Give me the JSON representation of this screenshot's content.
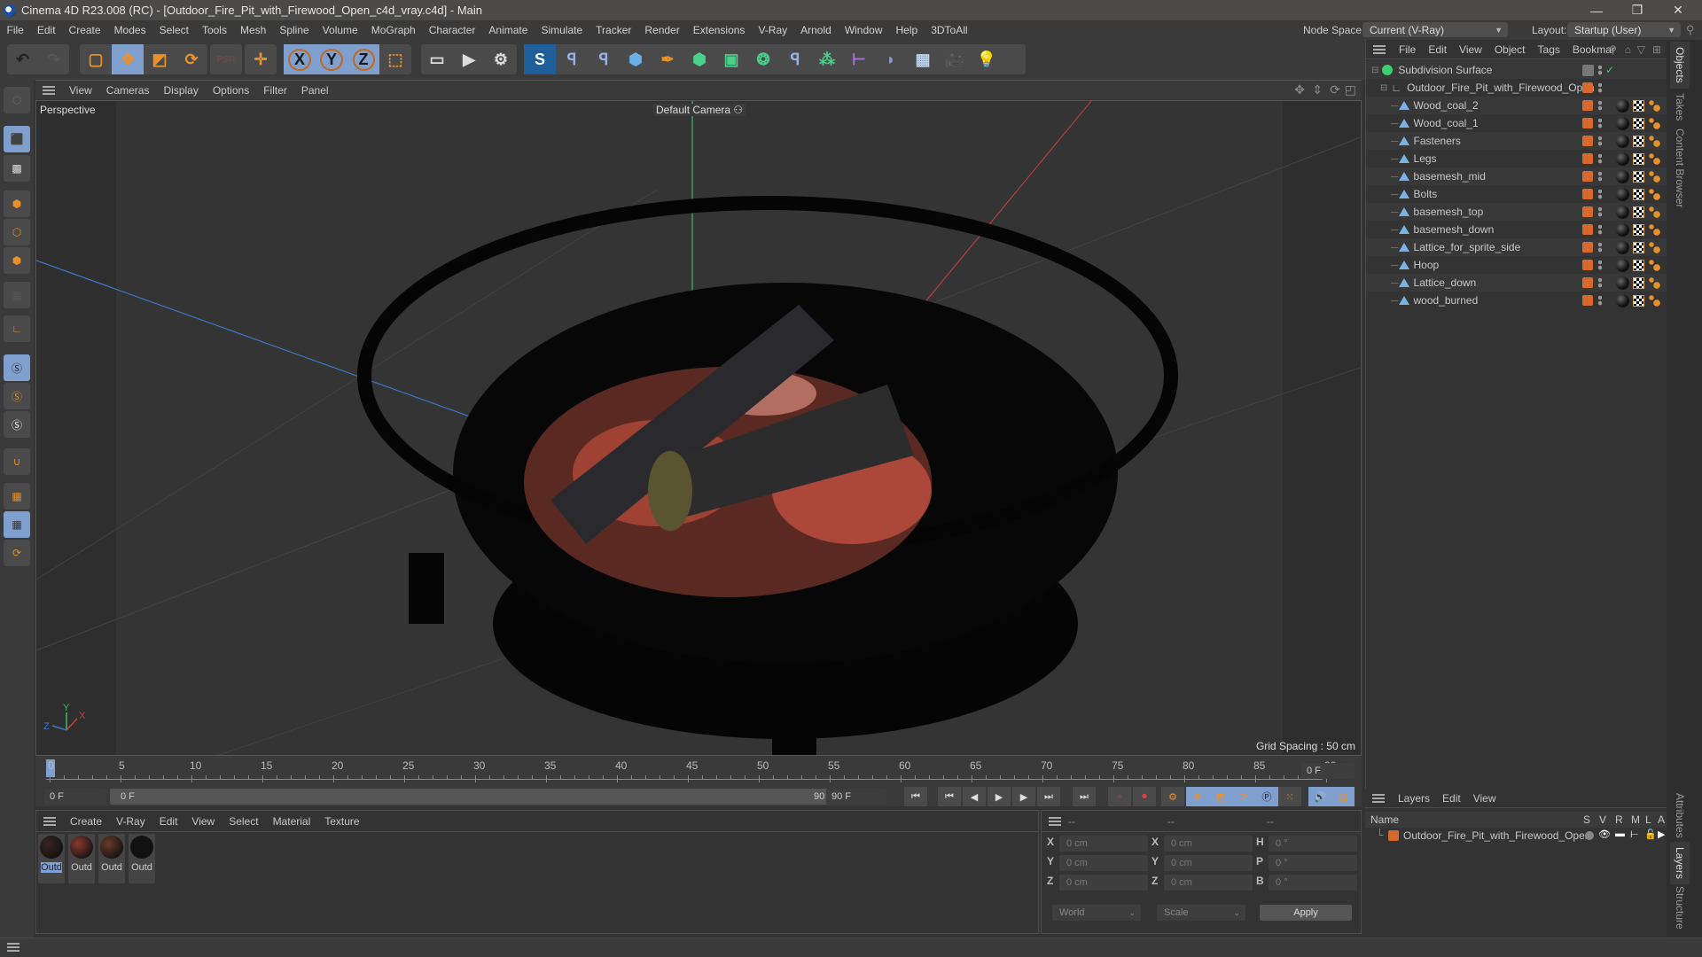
{
  "window": {
    "title": "Cinema 4D R23.008 (RC) - [Outdoor_Fire_Pit_with_Firewood_Open_c4d_vray.c4d] - Main",
    "controls": {
      "minimize": "—",
      "maximize": "❐",
      "close": "✕"
    }
  },
  "menubar": {
    "items": [
      "File",
      "Edit",
      "Create",
      "Modes",
      "Select",
      "Tools",
      "Mesh",
      "Spline",
      "Volume",
      "MoGraph",
      "Character",
      "Animate",
      "Simulate",
      "Tracker",
      "Render",
      "Extensions",
      "V-Ray",
      "Arnold",
      "Window",
      "Help",
      "3DToAll"
    ],
    "node_space_label": "Node Space:",
    "node_space_value": "Current (V-Ray)",
    "layout_label": "Layout:",
    "layout_value": "Startup (User)"
  },
  "toolbar": {
    "icons": [
      "undo-icon",
      "redo-icon",
      "live-selection-icon",
      "move-icon",
      "scale-icon",
      "rotate-icon",
      "psr-icon",
      "coordinate-system-icon",
      "x-axis-icon",
      "y-axis-icon",
      "z-axis-icon",
      "world-coords-icon",
      "render-view-icon",
      "render-picture-viewer-icon",
      "render-settings-icon",
      "vray-icon",
      "python-icon",
      "python-icon-2",
      "cube-icon",
      "pen-icon",
      "subdivision-icon",
      "extrude-icon",
      "deformer-icon",
      "python-icon-3",
      "mograph-cloner-icon",
      "symmetry-icon",
      "bend-icon",
      "floor-icon",
      "camera-icon",
      "light-icon"
    ],
    "axis_labels": [
      "X",
      "Y",
      "Z"
    ]
  },
  "viewport": {
    "menu": [
      "View",
      "Cameras",
      "Display",
      "Options",
      "Filter",
      "Panel"
    ],
    "view_name": "Perspective",
    "camera_label": "Default Camera",
    "grid_spacing": "Grid Spacing : 50 cm",
    "axis_labels": {
      "x": "X",
      "y": "Y",
      "z": "Z"
    }
  },
  "timeline": {
    "ticks": [
      "0",
      "5",
      "10",
      "15",
      "20",
      "25",
      "30",
      "35",
      "40",
      "45",
      "50",
      "55",
      "60",
      "65",
      "70",
      "75",
      "80",
      "85",
      "90"
    ],
    "current_frame": "0 F",
    "start_frame": "0 F",
    "range_start": "0 F",
    "range_end": "90 F",
    "end_frame": "90 F",
    "right_frame": "0 F"
  },
  "materials": {
    "menu": [
      "Create",
      "V-Ray",
      "Edit",
      "View",
      "Select",
      "Material",
      "Texture"
    ],
    "items": [
      {
        "label": "Outd",
        "color": "#3a2420",
        "selected": true
      },
      {
        "label": "Outd",
        "color": "#8a3a30",
        "selected": false
      },
      {
        "label": "Outd",
        "color": "#6a3a2a",
        "selected": false
      },
      {
        "label": "Outd",
        "color": "#111111",
        "selected": false
      }
    ]
  },
  "coordinates": {
    "headers": [
      "--",
      "--",
      "--"
    ],
    "rows": [
      {
        "l1": "X",
        "v1": "0 cm",
        "l2": "X",
        "v2": "0 cm",
        "l3": "H",
        "v3": "0 °"
      },
      {
        "l1": "Y",
        "v1": "0 cm",
        "l2": "Y",
        "v2": "0 cm",
        "l3": "P",
        "v3": "0 °"
      },
      {
        "l1": "Z",
        "v1": "0 cm",
        "l2": "Z",
        "v2": "0 cm",
        "l3": "B",
        "v3": "0 °"
      }
    ],
    "mode": "World",
    "size_mode": "Scale",
    "apply_label": "Apply"
  },
  "objects": {
    "menu": [
      "File",
      "Edit",
      "View",
      "Object",
      "Tags",
      "Bookmar"
    ],
    "root": "Subdivision Surface",
    "group": "Outdoor_Fire_Pit_with_Firewood_Open",
    "children": [
      "Wood_coal_2",
      "Wood_coal_1",
      "Fasteners",
      "Legs",
      "basemesh_mid",
      "Bolts",
      "basemesh_top",
      "basemesh_down",
      "Lattice_for_sprite_side",
      "Hoop",
      "Lattice_down",
      "wood_burned"
    ]
  },
  "layers": {
    "menu": [
      "Layers",
      "Edit",
      "View"
    ],
    "columns": [
      "Name",
      "S",
      "V",
      "R",
      "M",
      "L",
      "A"
    ],
    "items": [
      {
        "name": "Outdoor_Fire_Pit_with_Firewood_Open",
        "color": "#d8692e"
      }
    ]
  },
  "side_tabs": {
    "top": [
      "Objects",
      "Takes",
      "Content Browser"
    ],
    "bottom": [
      "Attributes",
      "Layers",
      "Structure"
    ]
  },
  "colors": {
    "accent": "#7f9fcf",
    "orange": "#e8902a",
    "layer": "#d8692e"
  }
}
